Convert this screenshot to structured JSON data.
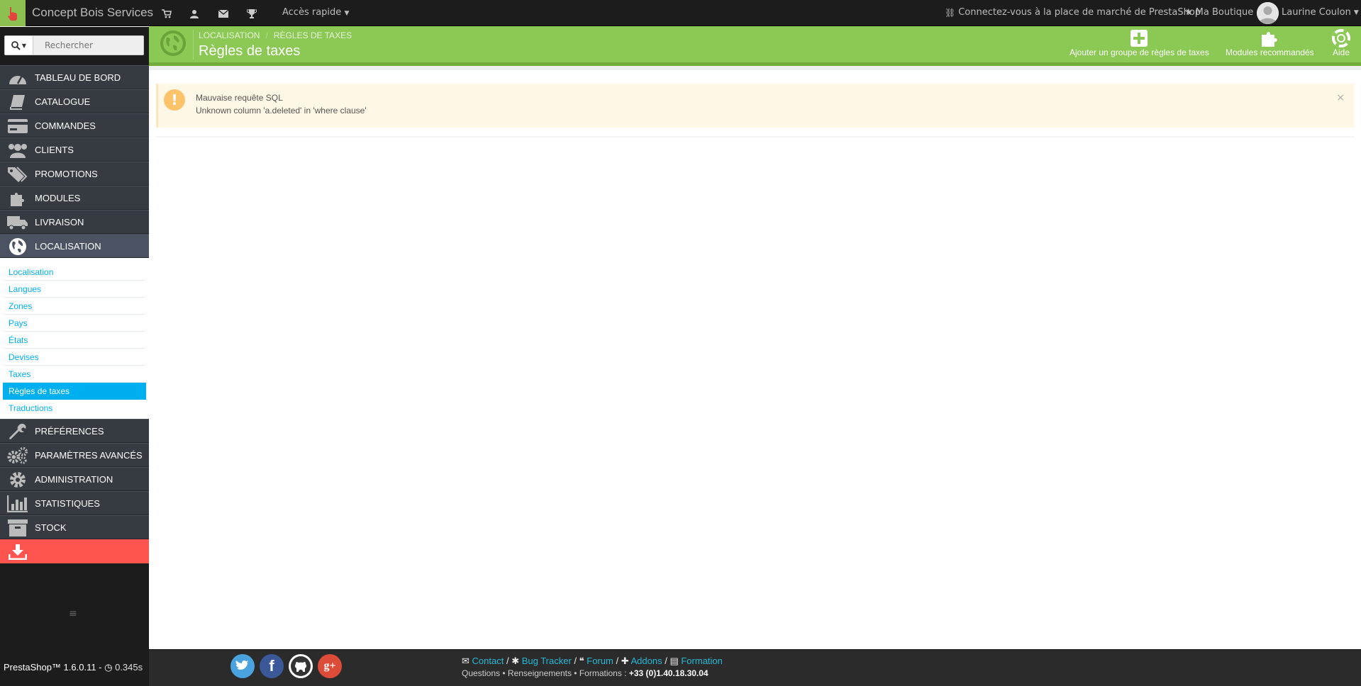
{
  "header": {
    "shop_name": "Concept Bois Services",
    "quick_access": "Accès rapide",
    "marketplace": "Connectez-vous à la place de marché de PrestaShop",
    "my_shop": "Ma Boutique",
    "user_name": "Laurine Coulon"
  },
  "sidebar": {
    "search_placeholder": "Rechercher",
    "items": [
      {
        "label": "TABLEAU DE BORD",
        "icon": "dashboard-icon"
      },
      {
        "label": "CATALOGUE",
        "icon": "book-icon"
      },
      {
        "label": "COMMANDES",
        "icon": "credit-card-icon"
      },
      {
        "label": "CLIENTS",
        "icon": "users-icon"
      },
      {
        "label": "PROMOTIONS",
        "icon": "tags-icon"
      },
      {
        "label": "MODULES",
        "icon": "puzzle-icon"
      },
      {
        "label": "LIVRAISON",
        "icon": "truck-icon"
      },
      {
        "label": "LOCALISATION",
        "icon": "globe-icon"
      }
    ],
    "submenu": [
      "Localisation",
      "Langues",
      "Zones",
      "Pays",
      "États",
      "Devises",
      "Taxes",
      "Règles de taxes",
      "Traductions"
    ],
    "active_submenu": "Règles de taxes",
    "items_after": [
      {
        "label": "PRÉFÉRENCES",
        "icon": "wrench-icon"
      },
      {
        "label": "PARAMÈTRES AVANCÉS",
        "icon": "cogs-icon"
      },
      {
        "label": "ADMINISTRATION",
        "icon": "gear-icon"
      },
      {
        "label": "STATISTIQUES",
        "icon": "bar-chart-icon"
      },
      {
        "label": "STOCK",
        "icon": "archive-icon"
      }
    ]
  },
  "page": {
    "breadcrumb_1": "LOCALISATION",
    "breadcrumb_2": "RÈGLES DE TAXES",
    "title": "Règles de taxes",
    "toolbar": {
      "add": "Ajouter un groupe de règles de taxes",
      "modules": "Modules recommandés",
      "help": "Aide"
    }
  },
  "alert": {
    "title": "Mauvaise requête SQL",
    "message": "Unknown column 'a.deleted' in 'where clause'",
    "close": "×"
  },
  "footer": {
    "version": "PrestaShop™ 1.6.0.11 - ",
    "time": "0.345s",
    "contact": "Contact",
    "bug_tracker": "Bug Tracker",
    "forum": "Forum",
    "addons": "Addons",
    "formation": "Formation",
    "info": "Questions • Renseignements • Formations : ",
    "phone": "+33 (0)1.40.18.30.04"
  },
  "colors": {
    "accent_green": "#8bc954",
    "sidebar_dark": "#363a41",
    "link_blue": "#00aff0",
    "alert_bg": "#fff8e6",
    "red_item": "#ff5450"
  }
}
